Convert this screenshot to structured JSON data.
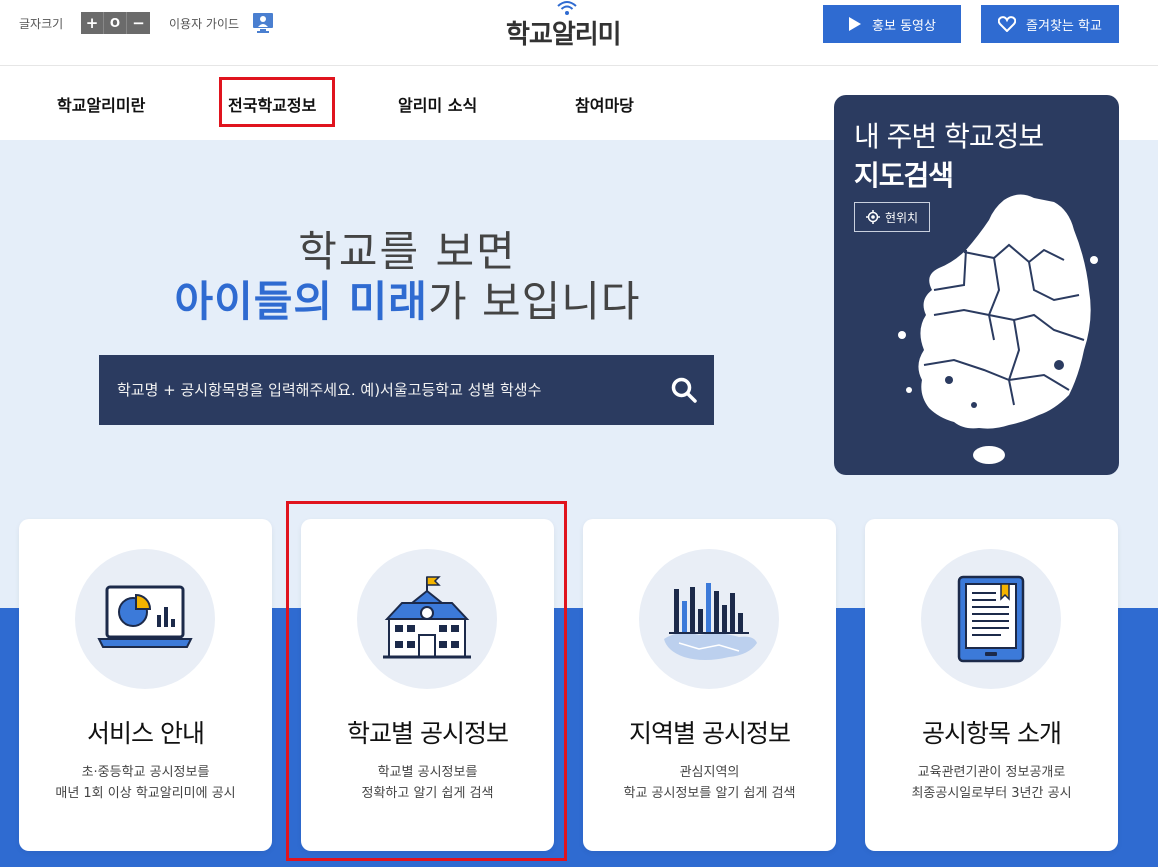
{
  "header": {
    "font_size_label": "글자크기",
    "font_size_buttons": [
      "+",
      "O",
      "−"
    ],
    "guide_label": "이용자 가이드",
    "guide_icon": "monitor-person-icon",
    "logo_text": "학교알리미",
    "promo_video_label": "홍보 동영상",
    "promo_icon": "play-icon",
    "favorite_label": "즐겨찾는 학교",
    "favorite_icon": "heart-icon"
  },
  "nav": {
    "items": [
      {
        "label": "학교알리미란"
      },
      {
        "label": "전국학교정보"
      },
      {
        "label": "알리미 소식"
      },
      {
        "label": "참여마당"
      }
    ]
  },
  "hero": {
    "line1": "학교를 보면",
    "line2_em": "아이들의 미래",
    "line2_rest": "가 보입니다"
  },
  "search": {
    "placeholder": "학교명 + 공시항목명을 입력해주세요. 예)서울고등학교 성별 학생수",
    "icon": "search-icon"
  },
  "map_card": {
    "title_line1": "내 주변 학교정보",
    "title_line2": "지도검색",
    "locate_label": "현위치",
    "locate_icon": "crosshair-icon"
  },
  "cards": [
    {
      "title": "서비스 안내",
      "desc1": "초·중등학교 공시정보를",
      "desc2": "매년 1회 이상 학교알리미에 공시",
      "icon": "laptop-chart-icon"
    },
    {
      "title": "학교별 공시정보",
      "desc1": "학교별 공시정보를",
      "desc2": "정확하고 알기 쉽게 검색",
      "icon": "school-building-icon"
    },
    {
      "title": "지역별 공시정보",
      "desc1": "관심지역의",
      "desc2": "학교 공시정보를 알기 쉽게 검색",
      "icon": "region-bar-chart-icon"
    },
    {
      "title": "공시항목 소개",
      "desc1": "교육관련기관이 정보공개로",
      "desc2": "최종공시일로부터 3년간 공시",
      "icon": "ebook-reader-icon"
    }
  ],
  "colors": {
    "primary_blue": "#2f6bd1",
    "navy": "#2b3b60",
    "hero_bg": "#e5eef9",
    "highlight_red": "#e0141e"
  }
}
